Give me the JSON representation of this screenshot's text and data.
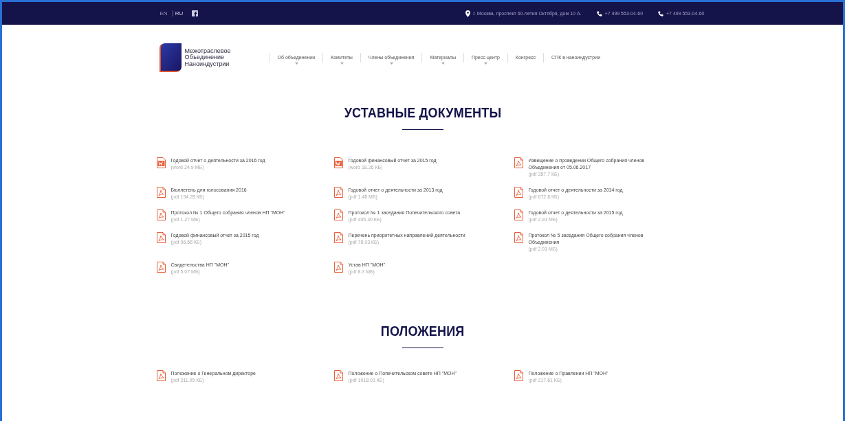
{
  "top_bar": {
    "languages": [
      {
        "label": "EN",
        "selected": false
      },
      {
        "label": "RU",
        "selected": true
      }
    ],
    "address": "г. Москва, проспект 60-летия Октября, дом 10 А.",
    "phones": [
      "+7 499 553-04-60",
      "+7 499 553-04-60"
    ]
  },
  "header": {
    "logo_text": [
      "Межотраслевое",
      "Объединение",
      "Наноиндустрии"
    ],
    "nav": [
      {
        "label": "Об объединении",
        "has_submenu": true
      },
      {
        "label": "Комитеты",
        "has_submenu": true
      },
      {
        "label": "Члены объединения",
        "has_submenu": true
      },
      {
        "label": "Материалы",
        "has_submenu": true
      },
      {
        "label": "Пресс-центр",
        "has_submenu": true
      },
      {
        "label": "Конгресс",
        "has_submenu": false
      },
      {
        "label": "СПК в наноиндустрии",
        "has_submenu": false
      }
    ]
  },
  "sections": [
    {
      "title": "УСТАВНЫЕ ДОКУМЕНТЫ",
      "documents": [
        {
          "kind": "word",
          "title": "Годовой отчет о деятельности за 2016 год",
          "meta": "(word 24.9 МБ)"
        },
        {
          "kind": "word",
          "title": "Годовой финансовый отчет за 2015 год",
          "meta": "(word 18.26 КБ)"
        },
        {
          "kind": "pdf",
          "title": "Извещение о проведении Общего собрания членов Объединения от 05.06.2017",
          "meta": "(pdf 357.7 КБ)"
        },
        {
          "kind": "pdf",
          "title": "Бюллетень для голосования 2016",
          "meta": "(pdf 194.28 КБ)"
        },
        {
          "kind": "pdf",
          "title": "Годовой отчет о деятельности за 2013 год",
          "meta": "(pdf 1.48 МБ)"
        },
        {
          "kind": "pdf",
          "title": "Годовой отчет о деятельности за 2014 год",
          "meta": "(pdf 672.8 КБ)"
        },
        {
          "kind": "pdf",
          "title": "Протокол № 1 Общего собрания членов НП \"МОН\"",
          "meta": "(pdf 1.27 МБ)"
        },
        {
          "kind": "pdf",
          "title": "Протокол № 1 заседания Попечительского совета",
          "meta": "(pdf 405.30 КБ)"
        },
        {
          "kind": "pdf",
          "title": "Годовой отчет о деятельности за 2015 год",
          "meta": "(pdf 2.91 МБ)"
        },
        {
          "kind": "pdf",
          "title": "Годовой финансовый отчет за 2015 год",
          "meta": "(pdf 96.55 КБ)"
        },
        {
          "kind": "pdf",
          "title": "Перечень приоритетных направлений деятельности",
          "meta": "(pdf 78.93 КБ)"
        },
        {
          "kind": "pdf",
          "title": "Протокол № 5 заседания Общего собрания членов Объединения",
          "meta": "(pdf 2.01 МБ)"
        },
        {
          "kind": "pdf",
          "title": "Свидетельства НП \"МОН\"",
          "meta": "(pdf 5.07 МБ)"
        },
        {
          "kind": "pdf",
          "title": "Устав НП \"МОН\"",
          "meta": "(pdf 8.3 МБ)"
        }
      ]
    },
    {
      "title": "ПОЛОЖЕНИЯ",
      "documents": [
        {
          "kind": "pdf",
          "title": "Положение о Генеральном директоре",
          "meta": "(pdf 211.05 КБ)"
        },
        {
          "kind": "pdf",
          "title": "Положение о Попечительском совете НП \"МОН\"",
          "meta": "(pdf 1018.03 КБ)"
        },
        {
          "kind": "pdf",
          "title": "Положение о Правлении НП \"МОН\"",
          "meta": "(pdf 217.61 КБ)"
        }
      ]
    }
  ]
}
